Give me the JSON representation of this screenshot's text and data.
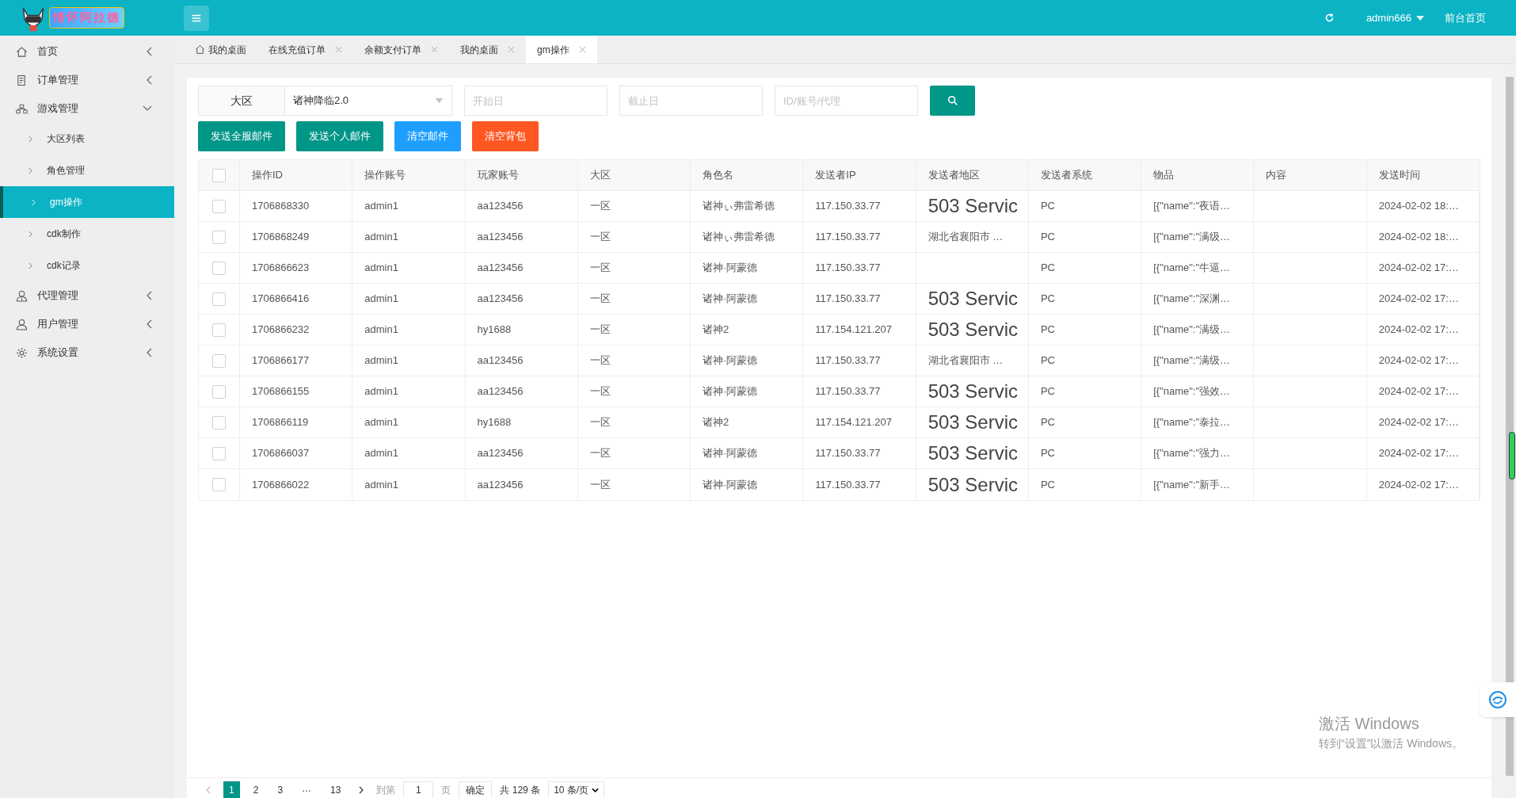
{
  "header": {
    "logo_text": "情怀阿拉德",
    "user": "admin666",
    "frontpage_link": "前台首页"
  },
  "sidebar": {
    "items": [
      {
        "label": "首页",
        "expanded": false,
        "selected": false
      },
      {
        "label": "订单管理",
        "expanded": false,
        "selected": false
      },
      {
        "label": "游戏管理",
        "expanded": true,
        "selected": false,
        "children": [
          {
            "label": "大区列表",
            "selected": false
          },
          {
            "label": "角色管理",
            "selected": false
          },
          {
            "label": "gm操作",
            "selected": true
          },
          {
            "label": "cdk制作",
            "selected": false
          },
          {
            "label": "cdk记录",
            "selected": false
          }
        ]
      },
      {
        "label": "代理管理",
        "expanded": false,
        "selected": false
      },
      {
        "label": "用户管理",
        "expanded": false,
        "selected": false
      },
      {
        "label": "系统设置",
        "expanded": false,
        "selected": false
      }
    ]
  },
  "tabs": [
    {
      "label": "我的桌面",
      "kind": "home",
      "selected": false
    },
    {
      "label": "在线充值订单",
      "kind": "closable",
      "selected": false
    },
    {
      "label": "余额支付订单",
      "kind": "closable",
      "selected": false
    },
    {
      "label": "我的桌面",
      "kind": "closable",
      "selected": false
    },
    {
      "label": "gm操作",
      "kind": "closable",
      "selected": true
    }
  ],
  "filters": {
    "zone_label": "大区",
    "zone_value": "诸神降临2.0",
    "start_placeholder": "开始日",
    "end_placeholder": "截止日",
    "search_placeholder": "ID/账号/代理"
  },
  "actions": [
    {
      "label": "发送全服邮件",
      "kind": "primary"
    },
    {
      "label": "发送个人邮件",
      "kind": "primary"
    },
    {
      "label": "清空邮件",
      "kind": "info"
    },
    {
      "label": "清空背包",
      "kind": "danger"
    }
  ],
  "table": {
    "all_checked": false,
    "columns": [
      "操作ID",
      "操作账号",
      "玩家账号",
      "大区",
      "角色名",
      "发送者IP",
      "发送者地区",
      "发送者系统",
      "物品",
      "内容",
      "发送时间"
    ],
    "rows": [
      {
        "checked": false,
        "cells": [
          "1706868330",
          "admin1",
          "aa123456",
          "一区",
          "诸神ぃ弗雷希德",
          "117.150.33.77",
          {
            "text": "503 Servic",
            "kind": "error"
          },
          "PC",
          "[{\"name\":\"夜语…",
          null,
          "2024-02-02 18:…"
        ]
      },
      {
        "checked": false,
        "cells": [
          "1706868249",
          "admin1",
          "aa123456",
          "一区",
          "诸神ぃ弗雷希德",
          "117.150.33.77",
          {
            "text": "湖北省襄阳市 …",
            "kind": "text"
          },
          "PC",
          "[{\"name\":\"满级…",
          null,
          "2024-02-02 18:…"
        ]
      },
      {
        "checked": false,
        "cells": [
          "1706866623",
          "admin1",
          "aa123456",
          "一区",
          "诸神·阿蒙德",
          "117.150.33.77",
          null,
          "PC",
          "[{\"name\":\"牛逼…",
          null,
          "2024-02-02 17:…"
        ]
      },
      {
        "checked": false,
        "cells": [
          "1706866416",
          "admin1",
          "aa123456",
          "一区",
          "诸神·阿蒙德",
          "117.150.33.77",
          {
            "text": "503 Servic",
            "kind": "error"
          },
          "PC",
          "[{\"name\":\"深渊…",
          null,
          "2024-02-02 17:…"
        ]
      },
      {
        "checked": false,
        "cells": [
          "1706866232",
          "admin1",
          "hy1688",
          "一区",
          "诸神2",
          "117.154.121.207",
          {
            "text": "503 Servic",
            "kind": "error"
          },
          "PC",
          "[{\"name\":\"满级…",
          null,
          "2024-02-02 17:…"
        ]
      },
      {
        "checked": false,
        "cells": [
          "1706866177",
          "admin1",
          "aa123456",
          "一区",
          "诸神·阿蒙德",
          "117.150.33.77",
          {
            "text": "湖北省襄阳市 …",
            "kind": "text"
          },
          "PC",
          "[{\"name\":\"满级…",
          null,
          "2024-02-02 17:…"
        ]
      },
      {
        "checked": false,
        "cells": [
          "1706866155",
          "admin1",
          "aa123456",
          "一区",
          "诸神·阿蒙德",
          "117.150.33.77",
          {
            "text": "503 Servic",
            "kind": "error"
          },
          "PC",
          "[{\"name\":\"强效…",
          null,
          "2024-02-02 17:…"
        ]
      },
      {
        "checked": false,
        "cells": [
          "1706866119",
          "admin1",
          "hy1688",
          "一区",
          "诸神2",
          "117.154.121.207",
          {
            "text": "503 Servic",
            "kind": "error"
          },
          "PC",
          "[{\"name\":\"泰拉…",
          null,
          "2024-02-02 17:…"
        ]
      },
      {
        "checked": false,
        "cells": [
          "1706866037",
          "admin1",
          "aa123456",
          "一区",
          "诸神·阿蒙德",
          "117.150.33.77",
          {
            "text": "503 Servic",
            "kind": "error"
          },
          "PC",
          "[{\"name\":\"强力…",
          null,
          "2024-02-02 17:…"
        ]
      },
      {
        "checked": false,
        "cells": [
          "1706866022",
          "admin1",
          "aa123456",
          "一区",
          "诸神·阿蒙德",
          "117.150.33.77",
          {
            "text": "503 Servic",
            "kind": "error"
          },
          "PC",
          "[{\"name\":\"新手…",
          null,
          "2024-02-02 17:…"
        ]
      }
    ]
  },
  "pagination": {
    "pages": [
      {
        "label": "1",
        "selected": true
      },
      {
        "label": "2",
        "selected": false
      },
      {
        "label": "3",
        "selected": false
      },
      {
        "label": "…",
        "kind": "ellipsis",
        "selected": false
      },
      {
        "label": "13",
        "selected": false
      }
    ],
    "goto_label": "到第",
    "goto_value": "1",
    "page_unit": "页",
    "confirm": "确定",
    "total": "共 129 条",
    "page_size": "10 条/页"
  },
  "activation_notice": {
    "title": "激活 Windows",
    "subtitle": "转到“设置”以激活 Windows。"
  }
}
